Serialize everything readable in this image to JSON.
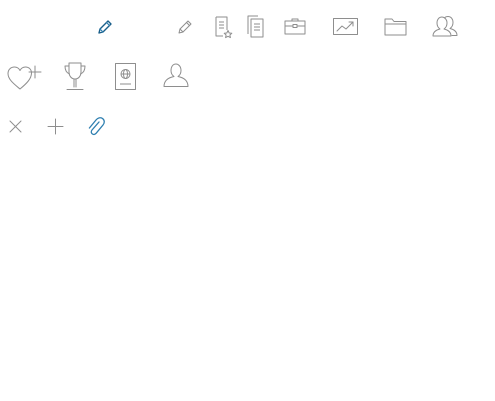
{
  "colors": {
    "icon_gray": "#8e8e8e",
    "icon_blue": "#2e7fb0",
    "icon_blue_dark": "#1a5f8a",
    "background": "#ffffff"
  },
  "icons": [
    {
      "name": "pencil-icon-active",
      "state": "active"
    },
    {
      "name": "pencil-icon",
      "state": "default"
    },
    {
      "name": "document-star-icon",
      "state": "default"
    },
    {
      "name": "documents-icon",
      "state": "default"
    },
    {
      "name": "briefcase-icon",
      "state": "default"
    },
    {
      "name": "chart-trend-icon",
      "state": "default"
    },
    {
      "name": "folder-open-icon",
      "state": "default"
    },
    {
      "name": "users-icon",
      "state": "default"
    },
    {
      "name": "heart-plus-icon",
      "state": "default"
    },
    {
      "name": "trophy-icon",
      "state": "default"
    },
    {
      "name": "passport-icon",
      "state": "default"
    },
    {
      "name": "user-icon",
      "state": "default"
    },
    {
      "name": "close-icon",
      "state": "default"
    },
    {
      "name": "plus-icon",
      "state": "default"
    },
    {
      "name": "paperclip-icon",
      "state": "active"
    }
  ]
}
